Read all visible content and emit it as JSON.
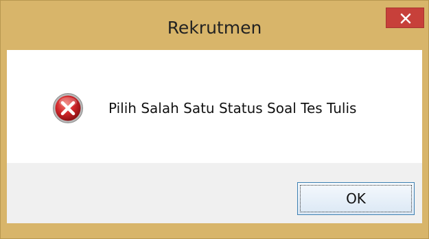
{
  "window": {
    "title": "Rekrutmen",
    "close_icon": "close-icon",
    "frame_color": "#d8b56a",
    "close_color": "#c7403a"
  },
  "dialog": {
    "icon": "error-icon",
    "message": "Pilih Salah Satu Status Soal Tes Tulis",
    "ok_label": "OK"
  }
}
